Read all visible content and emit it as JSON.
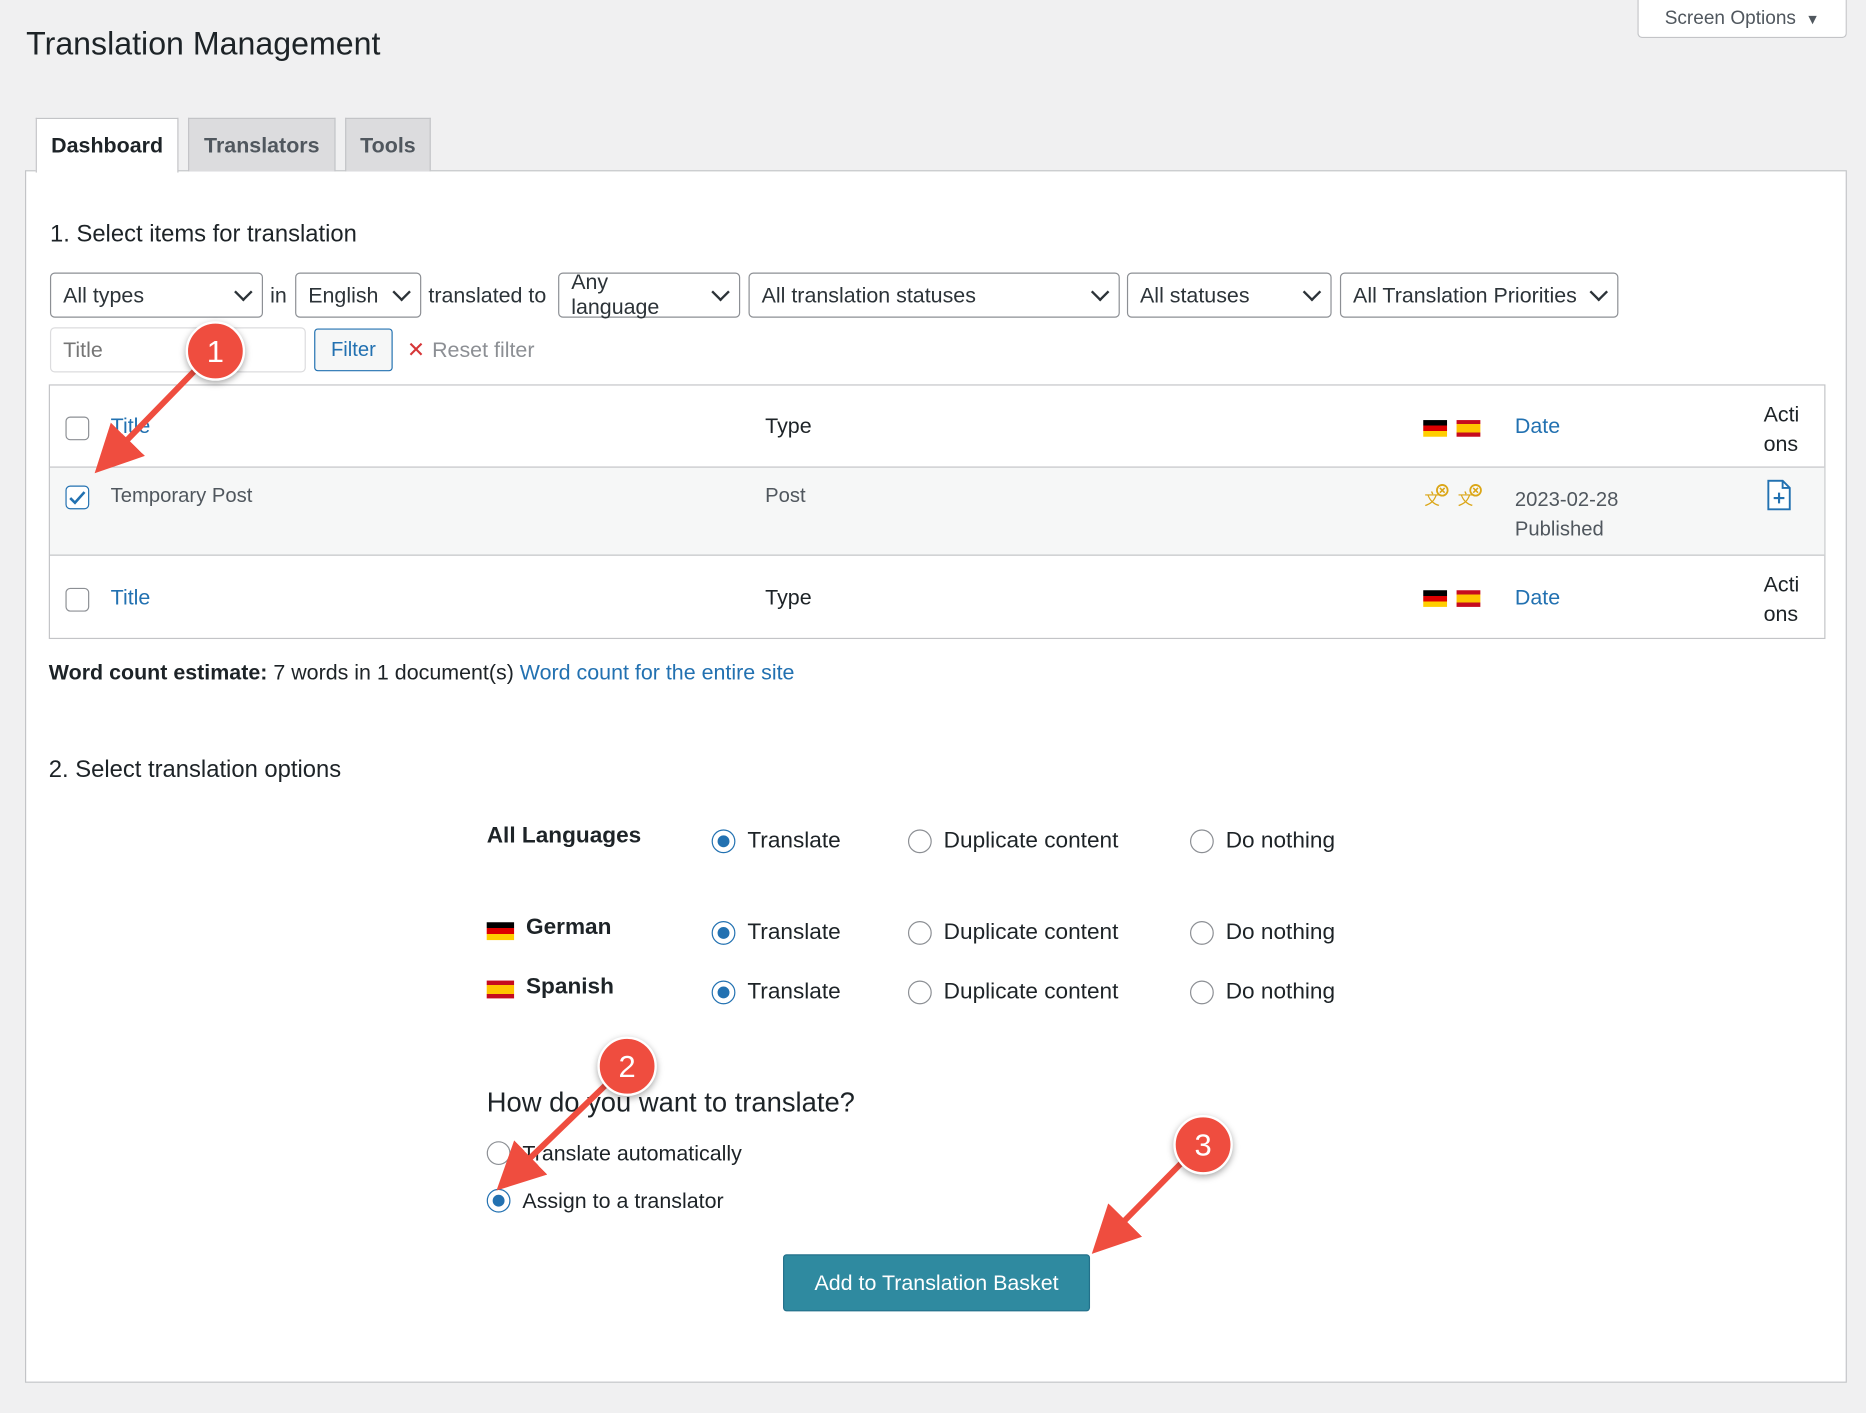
{
  "page": {
    "title": "Translation Management"
  },
  "screen_options": {
    "label": "Screen Options"
  },
  "tabs": [
    {
      "label": "Dashboard",
      "active": true
    },
    {
      "label": "Translators",
      "active": false
    },
    {
      "label": "Tools",
      "active": false
    }
  ],
  "section1": {
    "heading": "1. Select items for translation",
    "filters": {
      "type": "All types",
      "in_label": "in",
      "source_language": "English",
      "translated_to_label": "translated to",
      "target_language": "Any language",
      "translation_status": "All translation statuses",
      "status": "All statuses",
      "priority": "All Translation Priorities",
      "title_placeholder": "Title",
      "filter_button": "Filter",
      "reset_filter": "Reset filter"
    },
    "table": {
      "columns": {
        "title": "Title",
        "type": "Type",
        "date": "Date",
        "actions_line1": "Acti",
        "actions_line2": "ons"
      },
      "rows": [
        {
          "title": "Temporary Post",
          "type": "Post",
          "date": "2023-02-28",
          "status": "Published",
          "checked": true
        }
      ]
    },
    "word_count": {
      "label": "Word count estimate:",
      "value": "7 words in 1 document(s)",
      "link": "Word count for the entire site"
    }
  },
  "section2": {
    "heading": "2. Select translation options",
    "option_labels": {
      "translate": "Translate",
      "duplicate": "Duplicate content",
      "nothing": "Do nothing"
    },
    "rows": [
      {
        "label": "All Languages",
        "flag": null,
        "selected": "translate"
      },
      {
        "label": "German",
        "flag": "de",
        "selected": "translate"
      },
      {
        "label": "Spanish",
        "flag": "es",
        "selected": "translate"
      }
    ],
    "how_heading": "How do you want to translate?",
    "methods": [
      {
        "label": "Translate automatically",
        "selected": false
      },
      {
        "label": "Assign to a translator",
        "selected": true
      }
    ],
    "submit": "Add to Translation Basket"
  },
  "annotations": [
    "1",
    "2",
    "3"
  ],
  "colors": {
    "accent": "#2271b1",
    "button": "#2f8aa0",
    "badge": "#ef4d3f"
  }
}
